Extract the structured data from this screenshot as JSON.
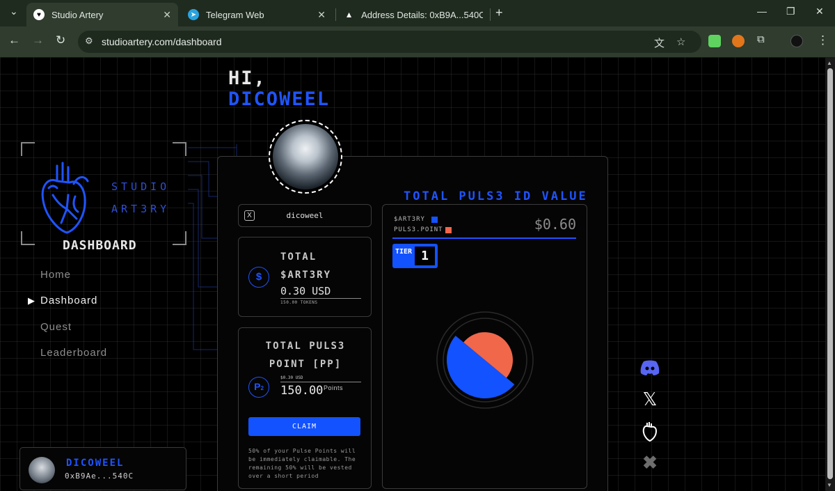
{
  "browser": {
    "tabs": [
      {
        "title": "Studio Artery",
        "active": true
      },
      {
        "title": "Telegram Web",
        "active": false
      },
      {
        "title": "Address Details: 0xB9A...540C |",
        "active": false
      }
    ],
    "url": "studioartery.com/dashboard"
  },
  "greeting": {
    "hi": "HI,",
    "name": "DICOWEEL"
  },
  "brand": {
    "line1": "STUDIO",
    "line2": "ART3RY",
    "section": "DASHBOARD"
  },
  "nav": {
    "items": [
      {
        "label": "Home",
        "active": false
      },
      {
        "label": "Dashboard",
        "active": true
      },
      {
        "label": "Quest",
        "active": false
      },
      {
        "label": "Leaderboard",
        "active": false
      }
    ]
  },
  "user": {
    "name": "DICOWEEL",
    "address": "0xB9Ae...540C"
  },
  "profile": {
    "x_handle": "dicoweel"
  },
  "artery_card": {
    "label1": "TOTAL",
    "label2": "$ART3RY",
    "value": "0.30 USD",
    "tokens": "150.00 TOKENS",
    "icon": "dollar-icon"
  },
  "pulse_card": {
    "label1": "TOTAL PULS3",
    "label2": "POINT [PP]",
    "usd": "$0.30 USD",
    "points": "150.00",
    "points_unit": "Points",
    "icon_main": "P",
    "icon_sub": "2"
  },
  "claim": {
    "button": "CLAIM",
    "note": "50% of your Pulse Points will be immediately claimable. The remaining 50% will be vested over a short period"
  },
  "value_panel": {
    "title": "TOTAL PULS3 ID VALUE",
    "legend": [
      {
        "label": "$ART3RY",
        "color": "#1352ff"
      },
      {
        "label": "PULS3.POINT",
        "color": "#f0674a"
      }
    ],
    "total": "$0.60",
    "tier_label": "TIER",
    "tier_value": "1"
  },
  "chart_data": {
    "type": "pie",
    "slices": [
      {
        "label": "$ART3RY",
        "value": 0.3,
        "color": "#1352ff"
      },
      {
        "label": "PULS3.POINT",
        "value": 0.3,
        "color": "#f0674a"
      }
    ]
  },
  "socials": [
    "discord-icon",
    "x-icon",
    "artery-heart-icon",
    "close-icon"
  ]
}
